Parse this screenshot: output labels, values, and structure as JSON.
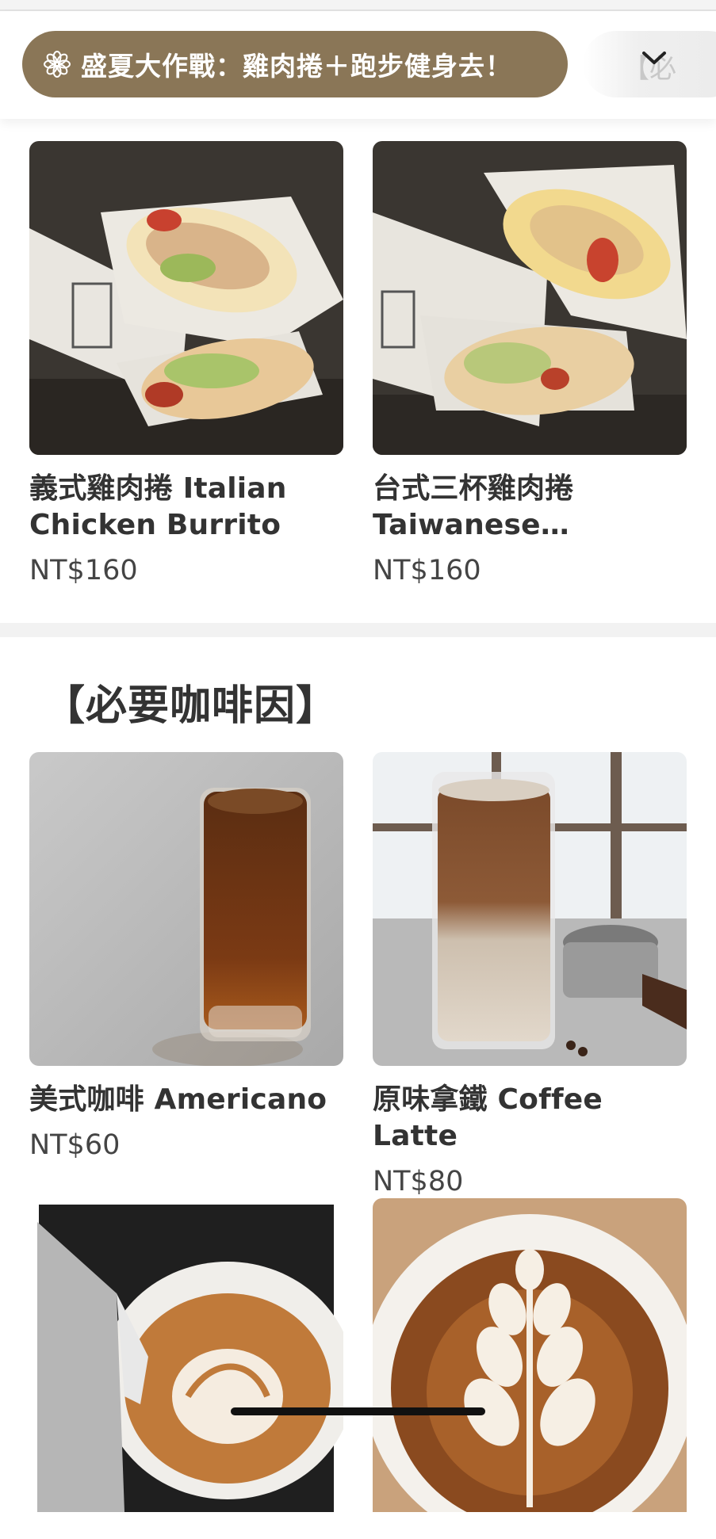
{
  "tabs": {
    "active_label": "盛夏大作戰：雞肉捲＋跑步健身去！",
    "next_label_peek": "【必",
    "active_color": "#8a7657",
    "expand_icon": "chevron-down-icon"
  },
  "sections": [
    {
      "items": [
        {
          "name": "義式雞肉捲 Italian Chicken Burrito",
          "price": "NT$160"
        },
        {
          "name": "台式三杯雞肉捲 Taiwanese Chicken…",
          "price": "NT$160"
        }
      ]
    },
    {
      "title": "【必要咖啡因】",
      "items": [
        {
          "name": "美式咖啡 Americano",
          "price": "NT$60"
        },
        {
          "name": "原味拿鐵 Coffee Latte",
          "price": "NT$80"
        },
        {
          "name": "",
          "price": ""
        },
        {
          "name": "",
          "price": ""
        }
      ]
    }
  ]
}
